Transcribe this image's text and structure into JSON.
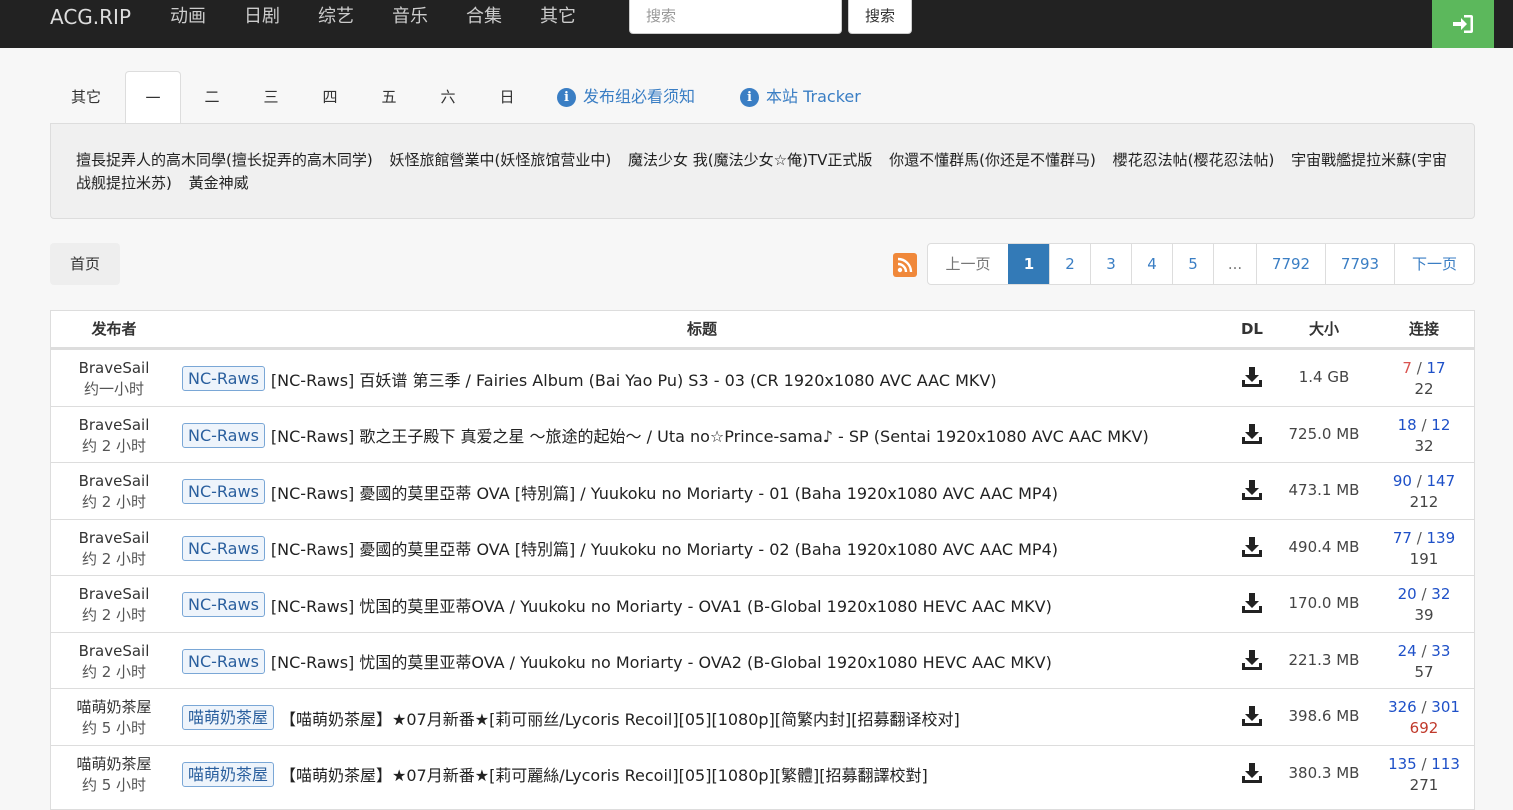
{
  "navbar": {
    "brand": "ACG.RIP",
    "links": [
      "动画",
      "日剧",
      "综艺",
      "音乐",
      "合集",
      "其它"
    ],
    "search_placeholder": "搜索",
    "search_button": "搜索",
    "login_icon": "login-icon"
  },
  "tabs": {
    "items": [
      "其它",
      "一",
      "二",
      "三",
      "四",
      "五",
      "六",
      "日"
    ],
    "active": "一",
    "link1": "发布组必看须知",
    "link2": "本站 Tracker"
  },
  "shows": [
    "擅長捉弄人的高木同學(擅长捉弄的高木同学)",
    "妖怪旅館營業中(妖怪旅馆营业中)",
    "魔法少女 我(魔法少女☆俺)TV正式版",
    "你還不懂群馬(你还是不懂群马)",
    "櫻花忍法帖(樱花忍法帖)",
    "宇宙戰艦提拉米蘇(宇宙战舰提拉米苏)",
    "黃金神威"
  ],
  "breadcrumb": {
    "home": "首页"
  },
  "pagination": {
    "prev": "上一页",
    "pages": [
      "1",
      "2",
      "3",
      "4",
      "5",
      "...",
      "7792",
      "7793"
    ],
    "current": "1",
    "next": "下一页"
  },
  "table": {
    "headers": {
      "publisher": "发布者",
      "title": "标题",
      "dl": "DL",
      "size": "大小",
      "conn": "连接"
    },
    "rows": [
      {
        "publisher": "BraveSail",
        "time": "约一小时",
        "tag": "NC-Raws",
        "title": "[NC-Raws] 百妖谱 第三季 / Fairies Album (Bai Yao Pu) S3 - 03 (CR 1920x1080 AVC AAC MKV)",
        "size": "1.4 GB",
        "seeders": "7",
        "leechers": "17",
        "completed": "22"
      },
      {
        "publisher": "BraveSail",
        "time": "约 2 小时",
        "tag": "NC-Raws",
        "title": "[NC-Raws] 歌之王子殿下 真爱之星 ～旅途的起始～ / Uta no☆Prince-sama♪ - SP (Sentai 1920x1080 AVC AAC MKV)",
        "size": "725.0 MB",
        "seeders": "18",
        "leechers": "12",
        "completed": "32"
      },
      {
        "publisher": "BraveSail",
        "time": "约 2 小时",
        "tag": "NC-Raws",
        "title": "[NC-Raws] 憂國的莫里亞蒂 OVA [特別篇] / Yuukoku no Moriarty - 01 (Baha 1920x1080 AVC AAC MP4)",
        "size": "473.1 MB",
        "seeders": "90",
        "leechers": "147",
        "completed": "212"
      },
      {
        "publisher": "BraveSail",
        "time": "约 2 小时",
        "tag": "NC-Raws",
        "title": "[NC-Raws] 憂國的莫里亞蒂 OVA [特別篇] / Yuukoku no Moriarty - 02 (Baha 1920x1080 AVC AAC MP4)",
        "size": "490.4 MB",
        "seeders": "77",
        "leechers": "139",
        "completed": "191"
      },
      {
        "publisher": "BraveSail",
        "time": "约 2 小时",
        "tag": "NC-Raws",
        "title": "[NC-Raws] 忧国的莫里亚蒂OVA / Yuukoku no Moriarty - OVA1 (B-Global 1920x1080 HEVC AAC MKV)",
        "size": "170.0 MB",
        "seeders": "20",
        "leechers": "32",
        "completed": "39"
      },
      {
        "publisher": "BraveSail",
        "time": "约 2 小时",
        "tag": "NC-Raws",
        "title": "[NC-Raws] 忧国的莫里亚蒂OVA / Yuukoku no Moriarty - OVA2 (B-Global 1920x1080 HEVC AAC MKV)",
        "size": "221.3 MB",
        "seeders": "24",
        "leechers": "33",
        "completed": "57"
      },
      {
        "publisher": "喵萌奶茶屋",
        "time": "约 5 小时",
        "tag": "喵萌奶茶屋",
        "title": "【喵萌奶茶屋】★07月新番★[莉可丽丝/Lycoris Recoil][05][1080p][简繁内封][招募翻译校对]",
        "size": "398.6 MB",
        "seeders": "326",
        "leechers": "301",
        "completed": "692"
      },
      {
        "publisher": "喵萌奶茶屋",
        "time": "约 5 小时",
        "tag": "喵萌奶茶屋",
        "title": "【喵萌奶茶屋】★07月新番★[莉可麗絲/Lycoris Recoil][05][1080p][繁體][招募翻譯校對]",
        "size": "380.3 MB",
        "seeders": "135",
        "leechers": "113",
        "completed": "271"
      }
    ]
  }
}
